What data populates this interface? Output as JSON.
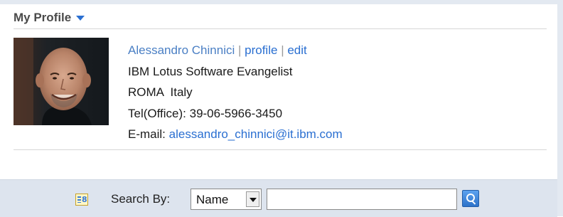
{
  "profile": {
    "header": "My Profile",
    "name": "Alessandro Chinnici",
    "separator": "|",
    "profile_link": "profile",
    "edit_link": "edit",
    "title": "IBM Lotus Software Evangelist",
    "location": "ROMA  Italy",
    "phone_label": "Tel(Office):",
    "phone": "39-06-5966-3450",
    "email_label": "E-mail:",
    "email": "alessandro_chinnici@it.ibm.com"
  },
  "search": {
    "label": "Search By:",
    "selected_option": "Name",
    "input_value": "",
    "directory_icon_text": "8"
  },
  "colors": {
    "link": "#2a6fd1",
    "name": "#4a7fc4",
    "search_bar_bg": "#dde4ee"
  }
}
